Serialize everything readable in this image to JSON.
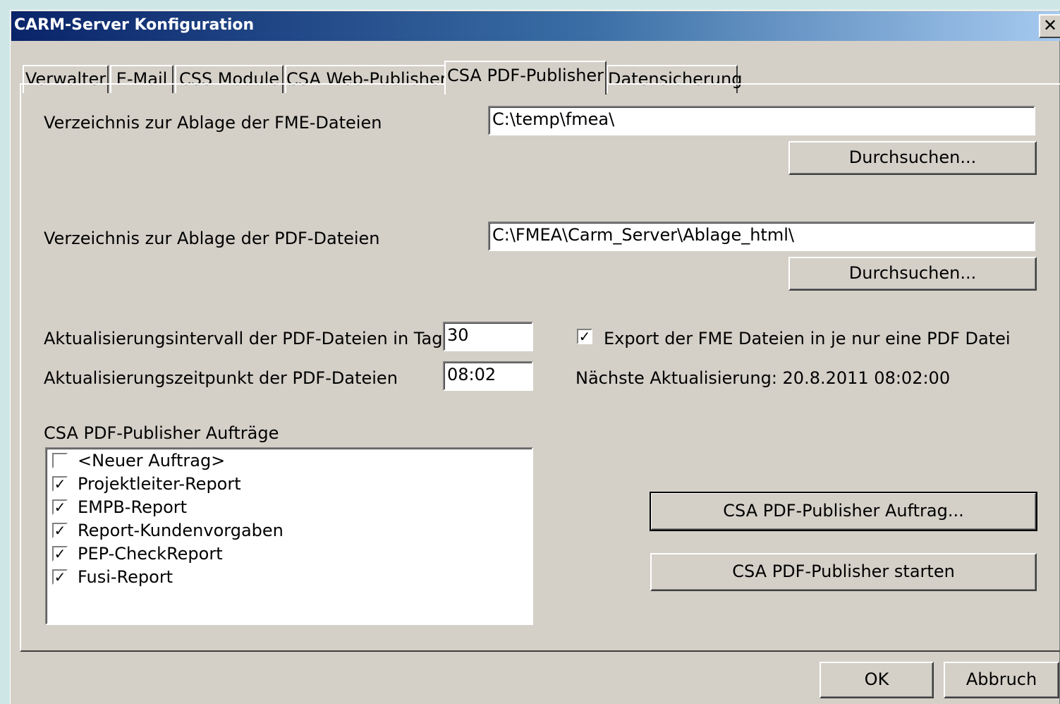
{
  "window": {
    "title": "CARM-Server Konfiguration",
    "close_glyph": "✕"
  },
  "tabs": [
    {
      "label": "Verwalter"
    },
    {
      "label": "E-Mail"
    },
    {
      "label": "CSS Module"
    },
    {
      "label": "CSA Web-Publisher"
    },
    {
      "label": "CSA PDF-Publisher",
      "active": true
    },
    {
      "label": "Datensicherung"
    }
  ],
  "fme": {
    "label": "Verzeichnis zur Ablage der FME-Dateien",
    "value": "C:\\temp\\fmea\\",
    "browse_label": "Durchsuchen..."
  },
  "pdf": {
    "label": "Verzeichnis zur Ablage der PDF-Dateien",
    "value": "C:\\FMEA\\Carm_Server\\Ablage_html\\",
    "browse_label": "Durchsuchen..."
  },
  "interval": {
    "label": "Aktualisierungsintervall der PDF-Dateien in Tagen",
    "value": "30"
  },
  "time": {
    "label": "Aktualisierungszeitpunkt der PDF-Dateien",
    "value": "08:02"
  },
  "export_single": {
    "label": "Export der FME Dateien in je nur eine PDF Datei",
    "checked": true
  },
  "next_update": "Nächste Aktualisierung: 20.8.2011 08:02:00",
  "jobs": {
    "label": "CSA PDF-Publisher Aufträge",
    "items": [
      {
        "label": "<Neuer Auftrag>",
        "checked": false
      },
      {
        "label": "Projektleiter-Report",
        "checked": true
      },
      {
        "label": "EMPB-Report",
        "checked": true
      },
      {
        "label": "Report-Kundenvorgaben",
        "checked": true
      },
      {
        "label": "PEP-CheckReport",
        "checked": true
      },
      {
        "label": "Fusi-Report",
        "checked": true
      }
    ]
  },
  "buttons": {
    "job": "CSA PDF-Publisher Auftrag...",
    "start": "CSA PDF-Publisher starten",
    "ok": "OK",
    "cancel": "Abbruch"
  },
  "check_glyph": "✓"
}
